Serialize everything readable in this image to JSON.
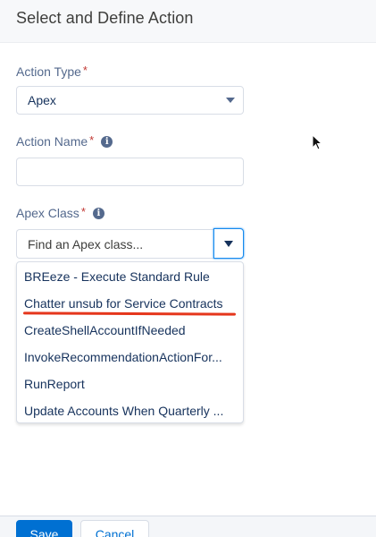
{
  "header": {
    "title": "Select and Define Action"
  },
  "action_type": {
    "label": "Action Type",
    "required_mark": "*",
    "value": "Apex"
  },
  "action_name": {
    "label": "Action Name",
    "required_mark": "*",
    "info_glyph": "i",
    "value": "",
    "placeholder": ""
  },
  "apex_class": {
    "label": "Apex Class",
    "required_mark": "*",
    "info_glyph": "i",
    "placeholder": "Find an Apex class...",
    "options": [
      "BREeze - Execute Standard Rule",
      "Chatter unsub for Service Contracts",
      "CreateShellAccountIfNeeded",
      "InvokeRecommendationActionFor...",
      "RunReport",
      "Update Accounts When Quarterly ..."
    ],
    "highlighted_option_index": 1
  },
  "footer": {
    "save_label": "Save",
    "cancel_label": "Cancel"
  },
  "colors": {
    "brand_blue": "#0070d2",
    "required_red": "#c23934",
    "annotation_underline": "#e5361c"
  }
}
